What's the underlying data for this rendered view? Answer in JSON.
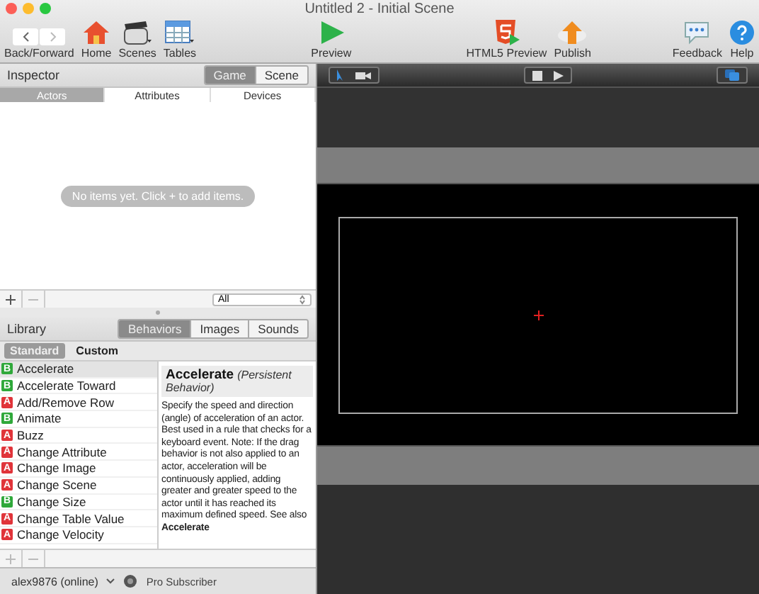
{
  "window": {
    "title": "Untitled 2 - Initial Scene"
  },
  "toolbar": {
    "nav_label": "Back/Forward",
    "items": [
      {
        "kind": "home",
        "label": "Home"
      },
      {
        "kind": "scenes",
        "label": "Scenes"
      },
      {
        "kind": "tables",
        "label": "Tables"
      },
      {
        "kind": "preview",
        "label": "Preview"
      },
      {
        "kind": "html5",
        "label": "HTML5 Preview"
      },
      {
        "kind": "publish",
        "label": "Publish"
      },
      {
        "kind": "feedback",
        "label": "Feedback"
      },
      {
        "kind": "help",
        "label": "Help"
      }
    ]
  },
  "inspector": {
    "title": "Inspector",
    "modes": [
      {
        "label": "Game",
        "selected": true
      },
      {
        "label": "Scene",
        "selected": false
      }
    ],
    "tabs": [
      {
        "label": "Actors",
        "selected": true
      },
      {
        "label": "Attributes",
        "selected": false
      },
      {
        "label": "Devices",
        "selected": false
      }
    ],
    "empty_message": "No items yet. Click + to add items.",
    "filter": "All"
  },
  "library": {
    "title": "Library",
    "tabs": [
      {
        "label": "Behaviors",
        "selected": true
      },
      {
        "label": "Images",
        "selected": false
      },
      {
        "label": "Sounds",
        "selected": false
      }
    ],
    "subtabs": [
      {
        "label": "Standard",
        "selected": true
      },
      {
        "label": "Custom",
        "selected": false
      }
    ],
    "behaviors": [
      {
        "badge": "B",
        "color": "#2fa83a",
        "name": "Accelerate",
        "selected": true
      },
      {
        "badge": "B",
        "color": "#2fa83a",
        "name": "Accelerate Toward",
        "selected": false
      },
      {
        "badge": "A",
        "color": "#e0343a",
        "name": "Add/Remove Row",
        "selected": false
      },
      {
        "badge": "B",
        "color": "#2fa83a",
        "name": "Animate",
        "selected": false
      },
      {
        "badge": "A",
        "color": "#e0343a",
        "name": "Buzz",
        "selected": false
      },
      {
        "badge": "A",
        "color": "#e0343a",
        "name": "Change Attribute",
        "selected": false
      },
      {
        "badge": "A",
        "color": "#e0343a",
        "name": "Change Image",
        "selected": false
      },
      {
        "badge": "A",
        "color": "#e0343a",
        "name": "Change Scene",
        "selected": false
      },
      {
        "badge": "B",
        "color": "#2fa83a",
        "name": "Change Size",
        "selected": false
      },
      {
        "badge": "A",
        "color": "#e0343a",
        "name": "Change Table Value",
        "selected": false
      },
      {
        "badge": "A",
        "color": "#e0343a",
        "name": "Change Velocity",
        "selected": false
      }
    ],
    "detail": {
      "title": "Accelerate",
      "subtitle": "(Persistent Behavior)",
      "body": "Specify the speed and direction (angle) of acceleration of an actor. Best used in a rule that checks for a keyboard event. Note: If the drag behavior is not also applied to an actor, acceleration will be continuously applied, adding greater and greater speed to the actor until it has reached its maximum defined speed. See also **Accelerate**"
    }
  },
  "status_bar": {
    "user": "alex9876 (online)",
    "plan": "Pro Subscriber"
  }
}
